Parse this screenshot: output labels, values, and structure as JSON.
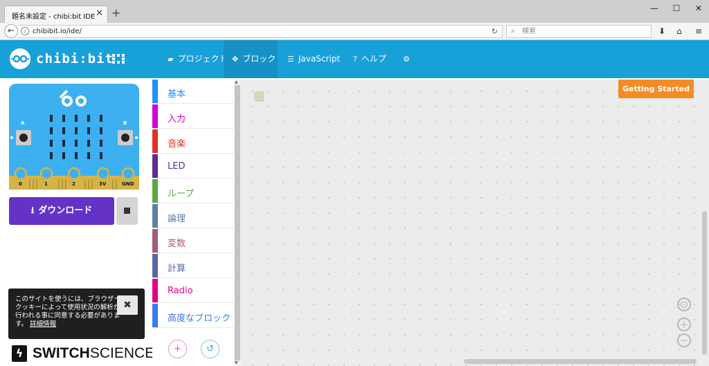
{
  "browser": {
    "tab_title": "題名未設定 - chibi:bit IDE",
    "url": "chibibit.io/ide/",
    "search_placeholder": "検索"
  },
  "app": {
    "logo_text": "chibi:bit",
    "menu": [
      {
        "label": "プロジェクト",
        "icon": "folder-icon"
      },
      {
        "label": "ブロック",
        "icon": "puzzle-icon",
        "active": true
      },
      {
        "label": "JavaScript",
        "icon": "code-icon"
      },
      {
        "label": "ヘルプ",
        "icon": "help-icon"
      },
      {
        "label": "",
        "icon": "gear-icon"
      }
    ]
  },
  "simulator": {
    "button_a": "A",
    "button_b": "B",
    "pins": [
      "0",
      "1",
      "2",
      "3V",
      "GND"
    ]
  },
  "download_label": "ダウンロード",
  "cookie": {
    "text": "このサイトを使うには、ブラウザークッキーによって使用状況の解析が行われる事に同意する必要があります。",
    "link": "詳細情報",
    "close": "✖"
  },
  "brand": {
    "bold": "SWITCH",
    "light": "SCIENCE"
  },
  "toolbox": {
    "categories": [
      {
        "label": "基本",
        "color": "#1e90ff"
      },
      {
        "label": "入力",
        "color": "#d400d4"
      },
      {
        "label": "音楽",
        "color": "#e63022"
      },
      {
        "label": "LED",
        "color": "#5c2d91"
      },
      {
        "label": "ループ",
        "color": "#58a944"
      },
      {
        "label": "論理",
        "color": "#5b80a5"
      },
      {
        "label": "変数",
        "color": "#a55b80"
      },
      {
        "label": "計算",
        "color": "#5b67a5"
      },
      {
        "label": "Radio",
        "color": "#e3008c"
      },
      {
        "label": "高度なブロック",
        "color": "#3c78f0"
      }
    ],
    "add_icon": "+",
    "undo_icon": "↺"
  },
  "workspace": {
    "getting_started": "Getting Started"
  },
  "colors": {
    "header": "#18a0d9",
    "download": "#6532c8",
    "getting_started": "#f58b23",
    "board": "#3cb0f0",
    "pins": "#d4b44a"
  }
}
